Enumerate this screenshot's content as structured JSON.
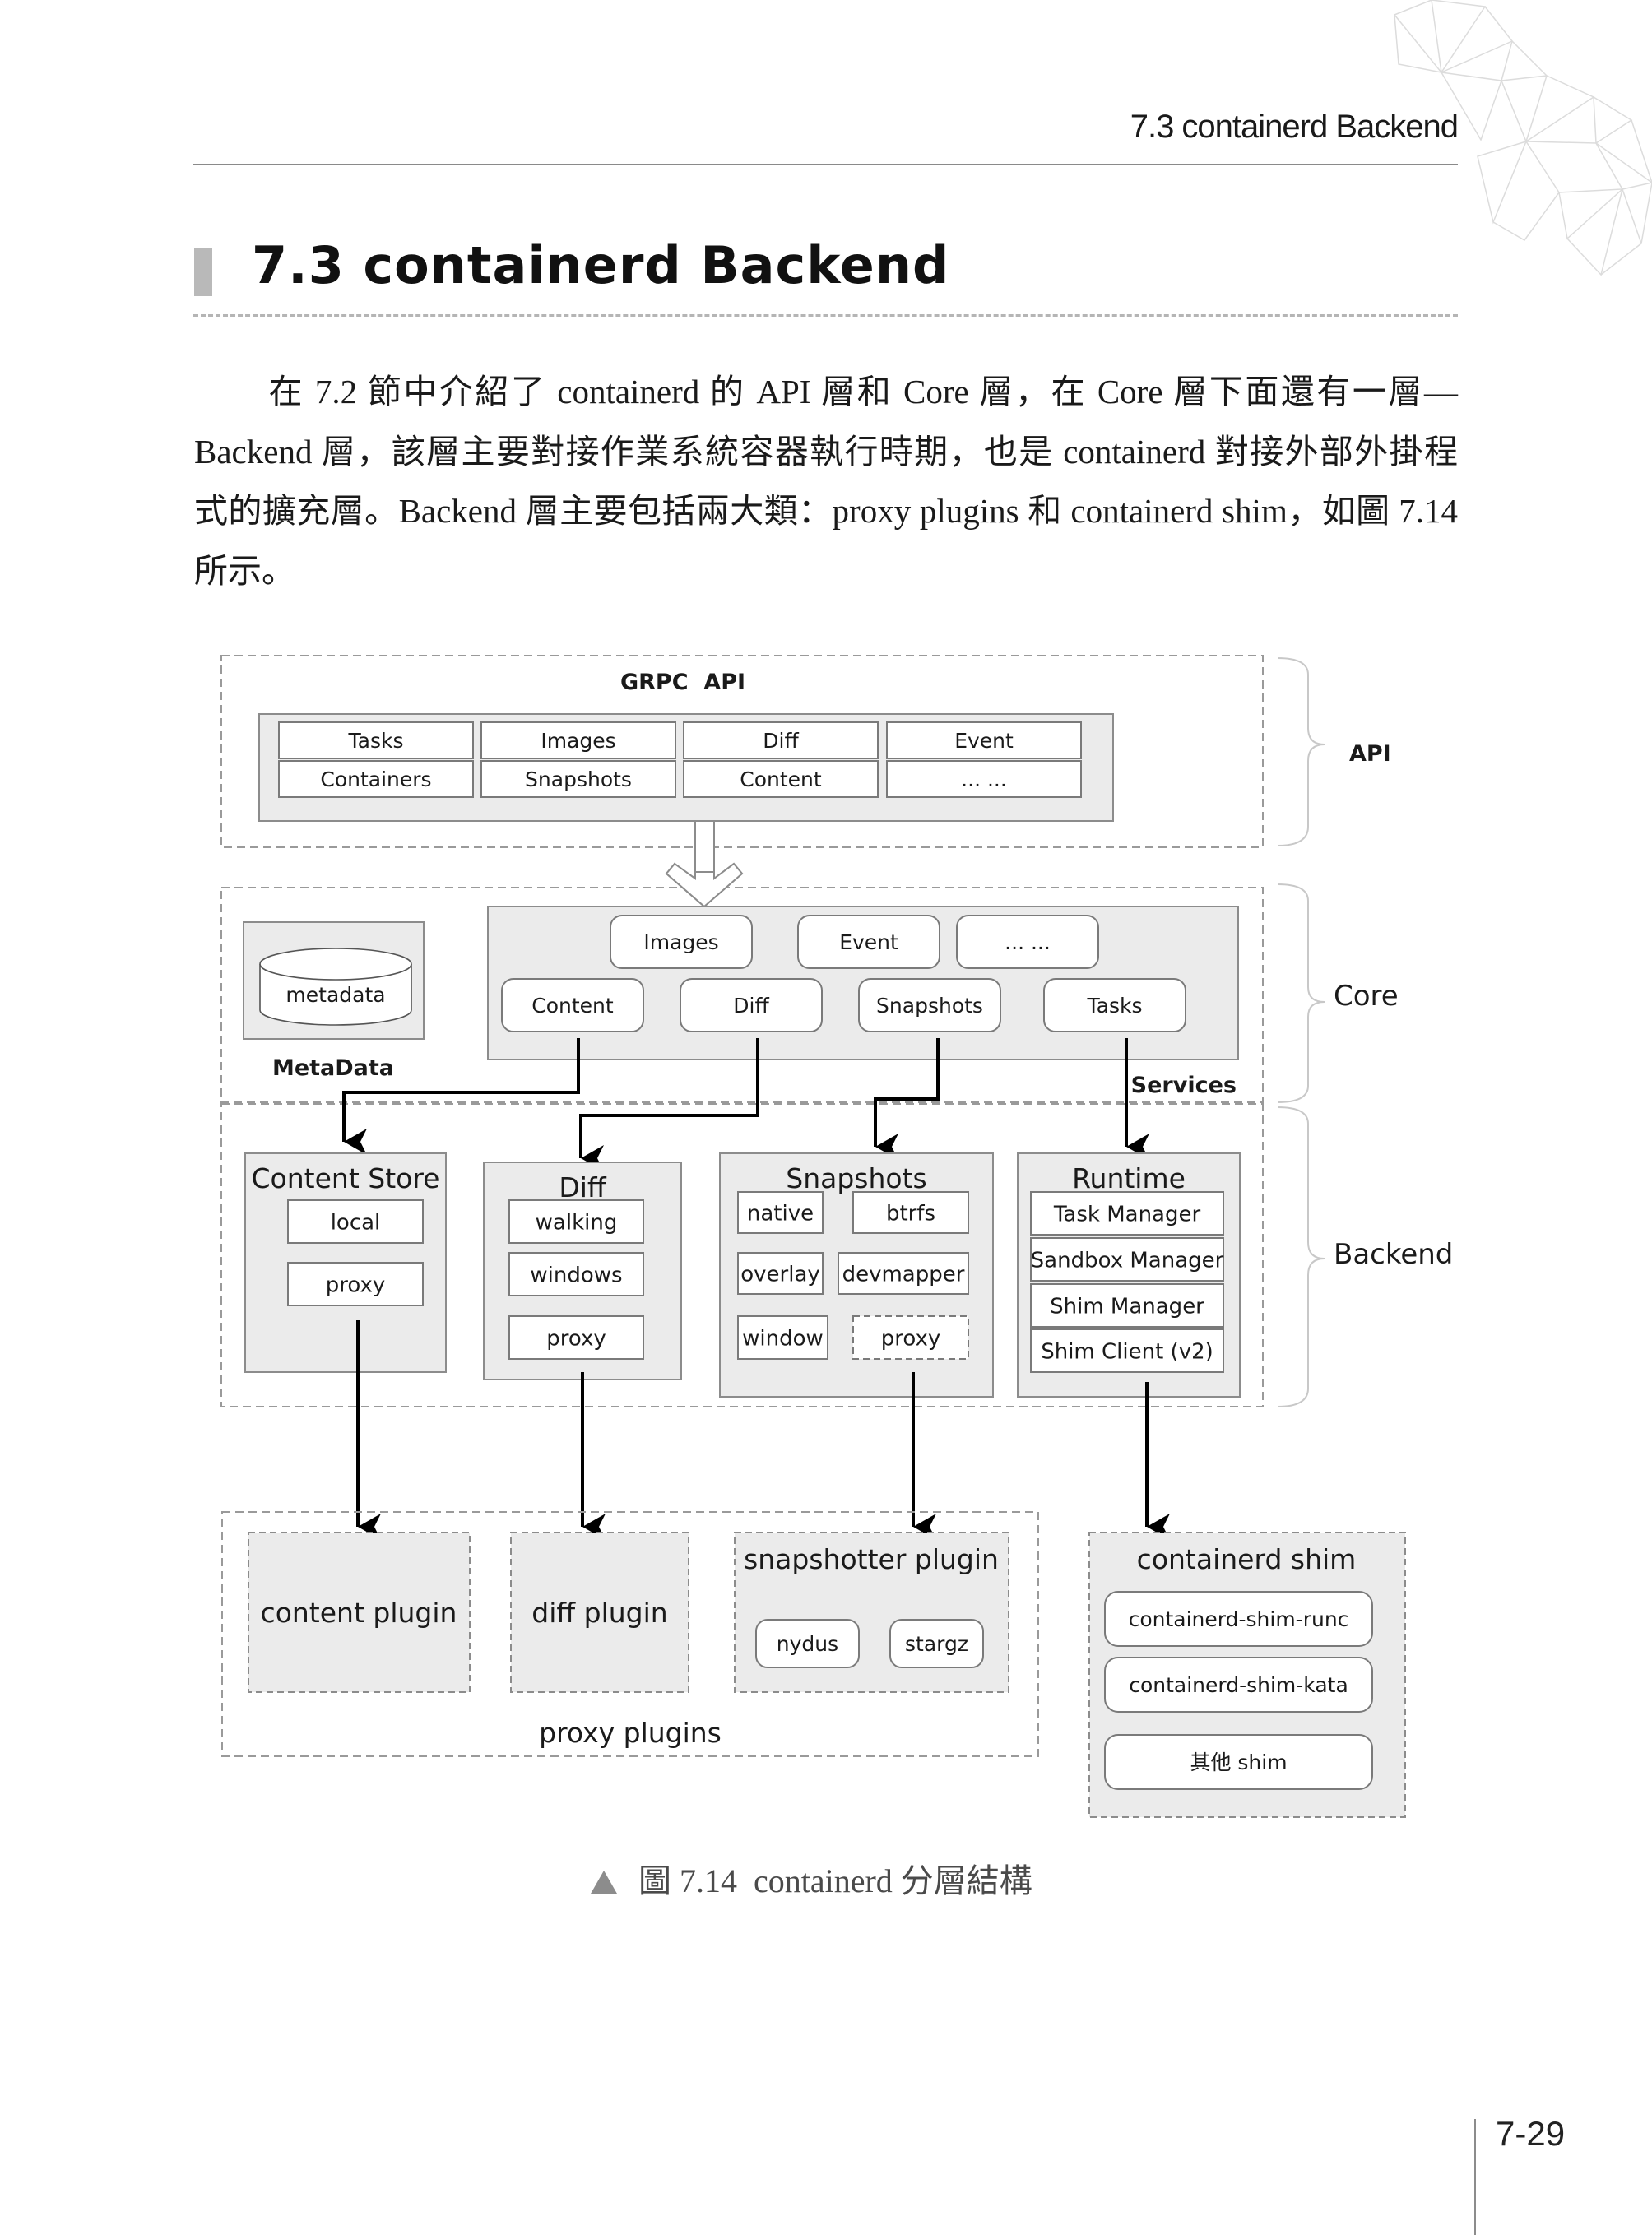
{
  "running_header": "7.3  containerd Backend",
  "section": {
    "title": "7.3  containerd Backend"
  },
  "paragraph": {
    "text": "在 7.2 節中介紹了 containerd 的 API 層和 Core 層，在 Core 層下面還有一層—Backend 層，該層主要對接作業系統容器執行時期，也是 containerd 對接外部外掛程式的擴充層。Backend 層主要包括兩大類：proxy plugins 和 containerd shim，如圖 7.14 所示。"
  },
  "diagram": {
    "layers": {
      "api": "API",
      "core": "Core",
      "backend": "Backend"
    },
    "api_section": {
      "title": "GRPC  API",
      "cells": [
        [
          "Tasks",
          "Images",
          "Diff",
          "Event"
        ],
        [
          "Containers",
          "Snapshots",
          "Content",
          "... ..."
        ]
      ]
    },
    "core_section": {
      "metadata_db": "metadata",
      "metadata_label": "MetaData",
      "services_label": "Services",
      "services_top": [
        "Images",
        "Event",
        "... ..."
      ],
      "services_bottom": [
        "Content",
        "Diff",
        "Snapshots",
        "Tasks"
      ]
    },
    "backend_section": {
      "content_store": {
        "title": "Content Store",
        "items": [
          "local",
          "proxy"
        ]
      },
      "diff": {
        "title": "Diff",
        "items": [
          "walking",
          "windows",
          "proxy"
        ]
      },
      "snapshots": {
        "title": "Snapshots",
        "items": [
          "native",
          "btrfs",
          "overlay",
          "devmapper",
          "window",
          "proxy"
        ]
      },
      "runtime": {
        "title": "Runtime",
        "items": [
          "Task Manager",
          "Sandbox Manager",
          "Shim Manager",
          "Shim Client (v2)"
        ]
      }
    },
    "proxy_plugins": {
      "label": "proxy plugins",
      "content_plugin": "content plugin",
      "diff_plugin": "diff plugin",
      "snapshotter_plugin": {
        "title": "snapshotter plugin",
        "items": [
          "nydus",
          "stargz"
        ]
      }
    },
    "containerd_shim": {
      "title": "containerd shim",
      "items": [
        "containerd-shim-runc",
        "containerd-shim-kata",
        "其他 shim"
      ]
    }
  },
  "caption": "圖 7.14  containerd 分層結構",
  "page_number": "7-29",
  "colors": {
    "box_fill": "#ebebeb",
    "box_stroke": "#8c8c8c",
    "dash_stroke": "#9a9a9a",
    "arrow": "#000000",
    "text": "#1a1a1a"
  }
}
